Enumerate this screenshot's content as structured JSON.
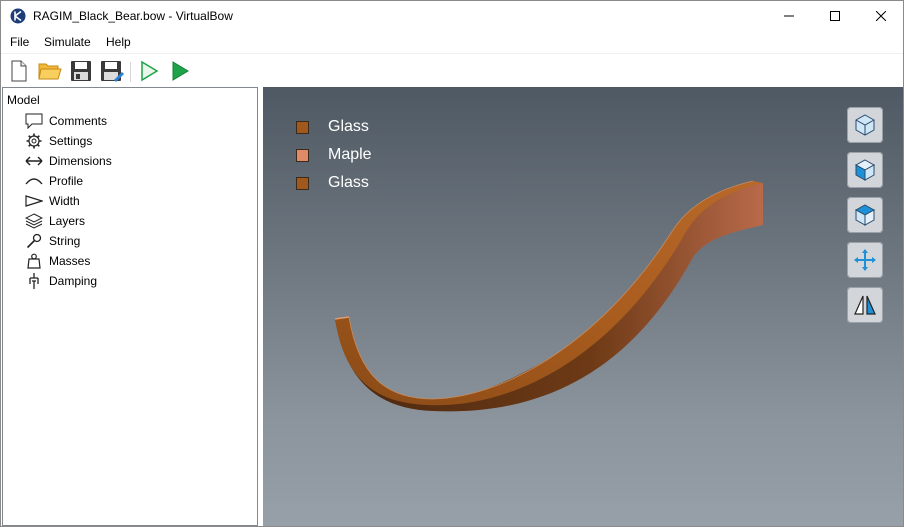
{
  "window": {
    "title": "RAGIM_Black_Bear.bow - VirtualBow"
  },
  "menu": {
    "file": "File",
    "simulate": "Simulate",
    "help": "Help"
  },
  "toolbar": {
    "icons": [
      "new-file-icon",
      "open-folder-icon",
      "save-icon",
      "save-as-icon",
      "run-static-icon",
      "run-dynamic-icon"
    ]
  },
  "tree": {
    "root": "Model",
    "items": [
      {
        "label": "Comments",
        "icon": "comment-icon"
      },
      {
        "label": "Settings",
        "icon": "gear-icon"
      },
      {
        "label": "Dimensions",
        "icon": "dimensions-arrow-icon"
      },
      {
        "label": "Profile",
        "icon": "profile-curve-icon"
      },
      {
        "label": "Width",
        "icon": "width-wedge-icon"
      },
      {
        "label": "Layers",
        "icon": "layers-icon"
      },
      {
        "label": "String",
        "icon": "string-icon"
      },
      {
        "label": "Masses",
        "icon": "weight-icon"
      },
      {
        "label": "Damping",
        "icon": "damper-icon"
      }
    ]
  },
  "viewport": {
    "legend": [
      {
        "label": "Glass",
        "color": "#a0581c"
      },
      {
        "label": "Maple",
        "color": "#e08a6a"
      },
      {
        "label": "Glass",
        "color": "#a0581c"
      }
    ],
    "view_buttons": [
      "view-3d-icon",
      "view-side-icon",
      "view-top-icon",
      "fit-view-icon",
      "mirror-view-icon"
    ]
  },
  "colors": {
    "accent_blue": "#1e90d8",
    "run_green": "#1fa34a",
    "bow_brown": "#a0581c"
  }
}
